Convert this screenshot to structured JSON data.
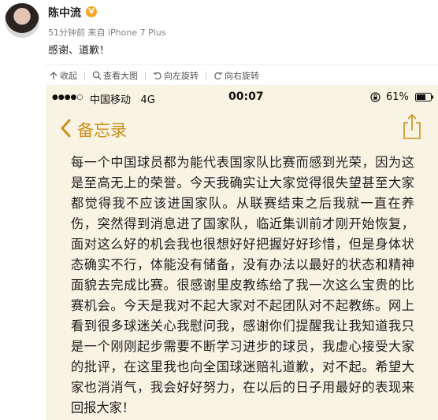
{
  "post": {
    "author": "陈中流",
    "verified_badge": "V",
    "meta": "51分钟前 来自 iPhone 7 Plus",
    "text": "感谢、道歉！"
  },
  "toolbar": {
    "collect": "收起",
    "view_large": "查看大图",
    "rotate_left": "向左旋转",
    "rotate_right": "向右旋转"
  },
  "phone": {
    "signal": "●●●●○",
    "carrier": "中国移动",
    "network": "4G",
    "time": "00:07",
    "battery": "61%",
    "nav_back": "备忘录",
    "note": "每一个中国球员都为能代表国家队比赛而感到光荣，因为这是至高无上的荣誉。今天我确实让大家觉得很失望甚至大家都觉得我不应该进国家队。从联赛结束之后我就一直在养伤，突然得到消息进了国家队，临近集训前才刚开始恢复，面对这么好的机会我也很想好好把握好好珍惜，但是身体状态确实不行，体能没有储备，没有办法以最好的状态和精神面貌去完成比赛。很感谢里皮教练给了我一次这么宝贵的比赛机会。今天是我对不起大家对不起团队对不起教练。网上看到很多球迷关心我慰问我，感谢你们提醒我让我知道我只是一个刚刚起步需要不断学习进步的球员，我虚心接受大家的批评，在这里我也向全国球迷赔礼道歉，对不起。希望大家也消消气，我会好好努力，在以后的日子用最好的表现来回报大家！"
  },
  "colors": {
    "accent": "#c9901d",
    "note_background": "#f8f3e3",
    "badge": "#f6a623"
  },
  "icons": [
    "collapse-icon",
    "magnifier-icon",
    "rotate-left-icon",
    "rotate-right-icon",
    "lock-rotation-icon",
    "battery-icon",
    "back-chevron-icon",
    "share-icon"
  ]
}
